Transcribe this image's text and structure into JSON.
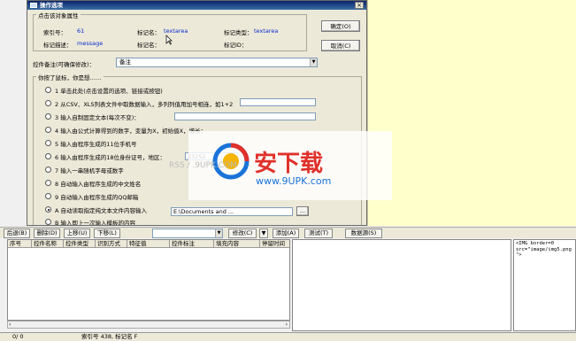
{
  "dialog": {
    "title": "操作选项",
    "close": "×",
    "props_group": "点击该对象属性",
    "index_label": "索引号：",
    "index_value": "61",
    "tag_label": "标记名：",
    "tag_value": "textarea",
    "tag_type_label": "标记类型：",
    "tag_type_value": "textarea",
    "tag_text_label": "标记描述：",
    "tag_text_value": "message",
    "tag_id_label": "标记名：",
    "tag_id_value": "",
    "tag_pid_label": "标记ID：",
    "tag_pid_value": "",
    "ok_button": "确定(O)",
    "cancel_button": "取消(C)",
    "remark_label": "控件备注(可确保修改)：",
    "remark_value": "备注",
    "actions_group": "你按了鼠标，你是想……",
    "options": [
      {
        "text": "1 单击此处(点击设置的选项、链接或按钮)",
        "selected": false
      },
      {
        "text": "2 从CSV、XLS列表文件中取数据输入，多列列值用加号相连，如1+2",
        "selected": false
      },
      {
        "text": "3 输入自制固定文本(每次不变)：",
        "selected": false
      },
      {
        "text": "4 输入由公式计算得到的数字，变量为X，初始值X，增长：",
        "selected": false
      },
      {
        "text": "5 输入由程序生成的11位手机号",
        "selected": false
      },
      {
        "text": "6 输入由程序生成的18位身份证号，地区：",
        "selected": false
      },
      {
        "text": "7 输入一串随机字母或数字",
        "selected": false
      },
      {
        "text": "8 自动输入由程序生成的中文姓名",
        "selected": false
      },
      {
        "text": "9 自动输入由程序生成的QQ邮箱",
        "selected": false
      },
      {
        "text": "A 自动读取指定纯文本文件内容输入",
        "selected": true
      },
      {
        "text": "B 输入即上一次输入模板的内容",
        "selected": false
      }
    ],
    "region_value": "33252",
    "file_path_value": "E:\\Documents and ...",
    "browse_button": "..."
  },
  "toolbar": {
    "buttons": [
      "后退(B)",
      "删除(D)",
      "上移(U)",
      "下移(L)",
      "修改(C)",
      "▼",
      "添加(A)",
      "测试(T)",
      "数据源(S)"
    ],
    "dropdown_value": ""
  },
  "grid": {
    "columns": [
      "序号",
      "控件名称",
      "控件类型",
      "识别方式",
      "特征值",
      "控件标注",
      "填充内容",
      "停留时间"
    ]
  },
  "code_pane": {
    "lines": [
      "<IMG border=0",
      "src=\"image/img5.png",
      "\">"
    ]
  },
  "status": {
    "left": "0/ 0",
    "middle": "索引号 438, 标记名 F"
  },
  "watermark": {
    "logo_text": "安下载",
    "url_text": "www.9UPK.com",
    "faint_text": "RSS / .9UPK.COM"
  },
  "colors": {
    "yellow_pane": "#ffffcc",
    "title_bar": "#0a246a",
    "value_text": "#0a2bd0",
    "watermark_red": "#e0302a",
    "watermark_blue": "#1a73d9"
  }
}
